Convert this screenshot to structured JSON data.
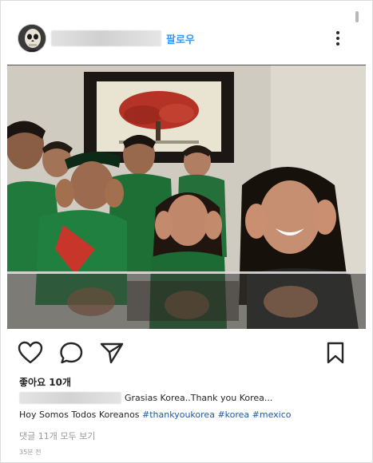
{
  "header": {
    "follow_label": "팔로우",
    "avatar_icon": "skull-mask-avatar",
    "more_icon": "more-vertical-icon"
  },
  "post": {
    "photo_description_icon": "group-selfie-photo"
  },
  "actions": {
    "like_icon": "heart-icon",
    "comment_icon": "comment-icon",
    "share_icon": "send-icon",
    "bookmark_icon": "bookmark-icon"
  },
  "likes_text": "좋아요 10개",
  "caption": {
    "line1": "Grasias Korea..Thank you Korea...",
    "line2_text": "Hoy Somos Todos Koreanos ",
    "hashtags": [
      "#thankyoukorea",
      "#korea",
      "#mexico"
    ]
  },
  "view_comments": "댓글 11개 모두 보기",
  "timestamp": "35분 전",
  "colors": {
    "link": "#3897f0",
    "hashtag": "#1e5aa8",
    "muted": "#999999",
    "text": "#262626"
  }
}
